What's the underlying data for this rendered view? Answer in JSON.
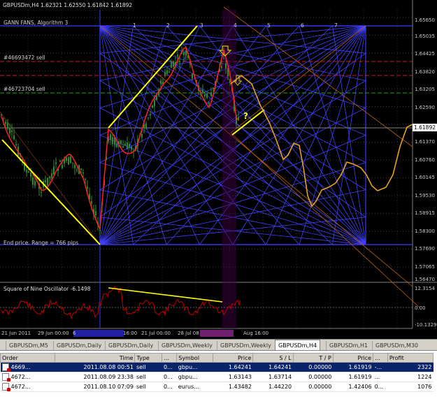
{
  "chart": {
    "title": "GBPUSDm,H4  1.62321 1.62550 1.61842 1.61892",
    "indicator_label": "GANN FANS, Algorithm 3",
    "order_line_1": "#46693472 sell",
    "order_line_2": "#46723704 sell",
    "end_price": "End price. Range = 766 pips",
    "fan_numbers": [
      "1",
      "2",
      "3",
      "4",
      "5",
      "6",
      "7"
    ],
    "question_mark": "?",
    "current_price": "1.61892",
    "y_labels": [
      "1.65650",
      "1.65035",
      "1.64425",
      "1.63820",
      "1.63205",
      "1.62590",
      "1.61892",
      "1.61370",
      "1.60760",
      "1.60145",
      "1.59530",
      "1.58915",
      "1.58300",
      "1.57690",
      "1.57065",
      "1.56470"
    ],
    "oscillator_title": "Square of Nine Oscillator -6.1498",
    "osc_labels": [
      "12.3154",
      "0.00",
      "-10.1329"
    ],
    "x_labels": [
      "21 Jun 2011",
      "29 Jun 00:00",
      "6",
      "16:00",
      "21 Jul 00:00",
      "28 Jul 08",
      "",
      "Aug 16:00"
    ],
    "colors": {
      "background": "#000000",
      "candles": "#2e8b2e",
      "ma": "#ff2020",
      "fan_blue": "#3a3aff",
      "projection": "#e8a020",
      "trend": "#ffff00",
      "osc": "#c00000"
    }
  },
  "tabs": [
    "GBPUSDm,M5",
    "GBPUSDm,Daily",
    "GBPUSDm,Daily",
    "GBPUSDm,Weekly",
    "GBPUSDm,Weekly",
    "GBPUSDm,H4",
    "GBPUSDm,H1",
    "GBPUSDm,M30"
  ],
  "active_tab": 5,
  "terminal": {
    "headers": [
      "Order",
      "Time",
      "Type",
      "...",
      "Symbol",
      "Price",
      "S / L",
      "T / P",
      "Price",
      "...",
      "Profit"
    ],
    "rows": [
      [
        "4669...",
        "2011.08.08 00:51",
        "sell",
        "0...",
        "gbpu...",
        "1.64241",
        "1.64241",
        "0.00000",
        "1.61919",
        "-...",
        "2322"
      ],
      [
        "4672...",
        "2011.08.09 23:38",
        "sell",
        "0...",
        "gbpu...",
        "1.63143",
        "1.63714",
        "0.00000",
        "1.61919",
        "...",
        "1224"
      ],
      [
        "4672...",
        "2011.08.10 07:09",
        "sell",
        "0...",
        "eurus...",
        "1.43482",
        "1.44220",
        "0.00000",
        "1.42406",
        "0...",
        "1076"
      ]
    ]
  }
}
